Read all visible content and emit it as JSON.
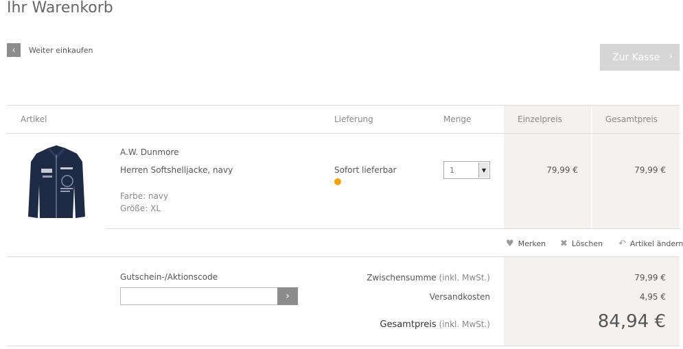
{
  "page": {
    "title": "Ihr Warenkorb"
  },
  "nav": {
    "back_label": "Weiter einkaufen",
    "checkout_label": "Zur Kasse"
  },
  "table": {
    "headers": {
      "article": "Artikel",
      "delivery": "Lieferung",
      "quantity": "Menge",
      "unit_price": "Einzelpreis",
      "total_price": "Gesamtpreis"
    }
  },
  "item": {
    "brand": "A.W. Dunmore",
    "name": "Herren Softshelljacke, navy",
    "color": "Farbe: navy",
    "size": "Größe: XL",
    "availability": "Sofort lieferbar",
    "availability_color": "#f2a20a",
    "quantity": "1",
    "unit_price": "79,99 €",
    "total_price": "79,99 €",
    "image_icon": "jacket-image"
  },
  "actions": {
    "wishlist": "Merken",
    "delete": "Löschen",
    "edit": "Artikel ändern"
  },
  "coupon": {
    "label": "Gutschein-/Aktionscode",
    "value": ""
  },
  "summary": {
    "subtotal_label": "Zwischensumme",
    "subtotal_note": "(inkl. MwSt.)",
    "subtotal_value": "79,99 €",
    "shipping_label": "Versandkosten",
    "shipping_value": "4,95 €",
    "total_label": "Gesamtpreis",
    "total_note": "(inkl. MwSt.)",
    "total_value": "84,94 €"
  },
  "colors": {
    "button_gray": "#8c8c8c",
    "checkout_disabled": "#d6d6d6",
    "panel_bg": "#f3f2f1"
  }
}
